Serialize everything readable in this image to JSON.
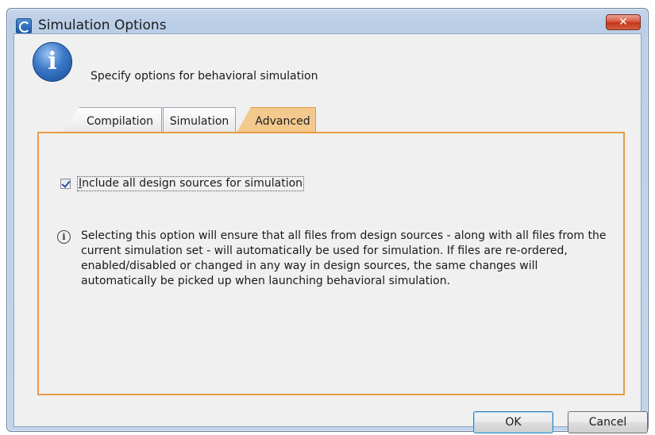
{
  "window": {
    "title": "Simulation Options",
    "close_label": "✕"
  },
  "header": {
    "message": "Specify options for behavioral simulation"
  },
  "tabs": [
    {
      "label": "Compilation",
      "selected": false
    },
    {
      "label": "Simulation",
      "selected": false
    },
    {
      "label": "Advanced",
      "selected": true
    }
  ],
  "advanced": {
    "include_sources": {
      "label": "Include all design sources for simulation",
      "checked": true
    },
    "info_text": "Selecting this option will ensure that all files from design sources - along with all files from the current simulation set - will automatically be used for simulation. If files are re-ordered, enabled/disabled or changed in any way in design sources, the same changes will automatically be picked up when launching behavioral simulation."
  },
  "buttons": {
    "ok": "OK",
    "cancel": "Cancel"
  },
  "colors": {
    "selected_tab_accent": "#e59b45",
    "title_bar": "#bcd0e8",
    "close_button": "#c4331b"
  }
}
